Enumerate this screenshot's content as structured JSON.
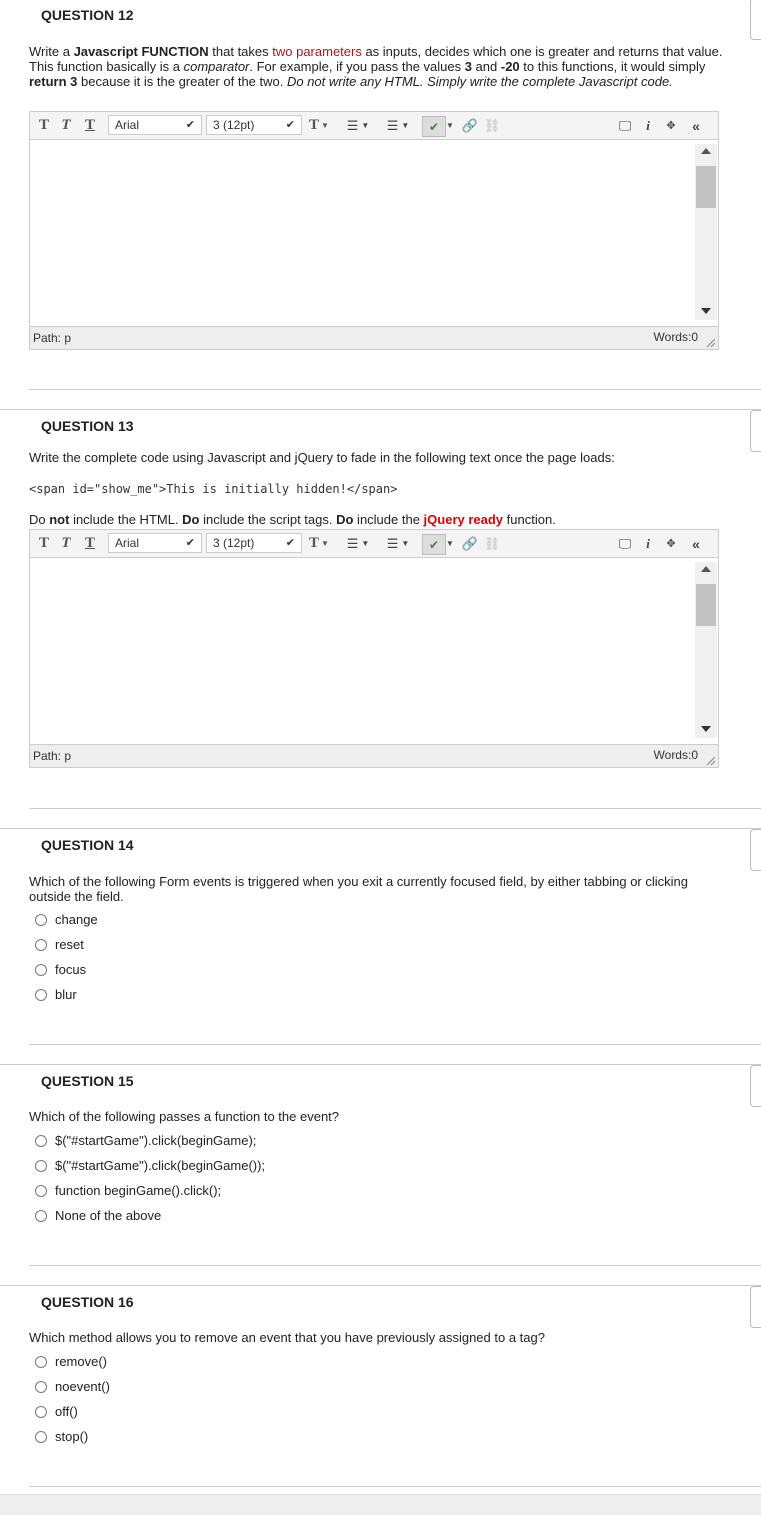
{
  "editor_common": {
    "font_family": "Arial",
    "font_size": "3 (12pt)",
    "path_label": "Path: p",
    "words_label": "Words:0",
    "icons": [
      "bold-icon",
      "italic-icon",
      "underline-icon",
      "text-color-icon",
      "bullet-list-icon",
      "numbered-list-icon",
      "spellcheck-icon",
      "link-icon",
      "unlink-icon",
      "preview-icon",
      "info-icon",
      "fullscreen-icon",
      "collapse-icon"
    ]
  },
  "q12": {
    "title": "QUESTION 12",
    "text_parts": [
      "Write a ",
      "Javascript FUNCTION",
      " that takes ",
      "two parameters",
      " as inputs, decides which one is greater and returns that value. This function basically is a ",
      "comparator",
      ". For example, if you pass the values ",
      "3",
      " and ",
      "-20",
      " to this functions, it would simply ",
      "return 3",
      " because it is the greater of the two. ",
      "Do not write any HTML. Simply write the complete Javascript code."
    ]
  },
  "q13": {
    "title": "QUESTION 13",
    "text": "Write the complete code using Javascript and jQuery to fade in the following text once the page loads:",
    "code": "<span id=\"show_me\">This is initially hidden!</span>",
    "instr_parts": [
      "Do ",
      "not",
      " include the HTML. ",
      "Do",
      " include the script tags. ",
      "Do",
      " include the ",
      "jQuery ready",
      " function."
    ]
  },
  "q14": {
    "title": "QUESTION 14",
    "text": "Which of the following Form events is triggered when you exit a currently focused field, by either tabbing or clicking outside the field.",
    "options": [
      "change",
      "reset",
      "focus",
      "blur"
    ]
  },
  "q15": {
    "title": "QUESTION 15",
    "text": "Which of the following passes a function to the event?",
    "options": [
      "$(\"#startGame\").click(beginGame);",
      "$(\"#startGame\").click(beginGame());",
      "function beginGame().click();",
      "None of the above"
    ]
  },
  "q16": {
    "title": "QUESTION 16",
    "text": "Which method allows you to remove an event that you have previously assigned to a tag?",
    "options": [
      "remove()",
      "noevent()",
      "off()",
      "stop()"
    ]
  }
}
